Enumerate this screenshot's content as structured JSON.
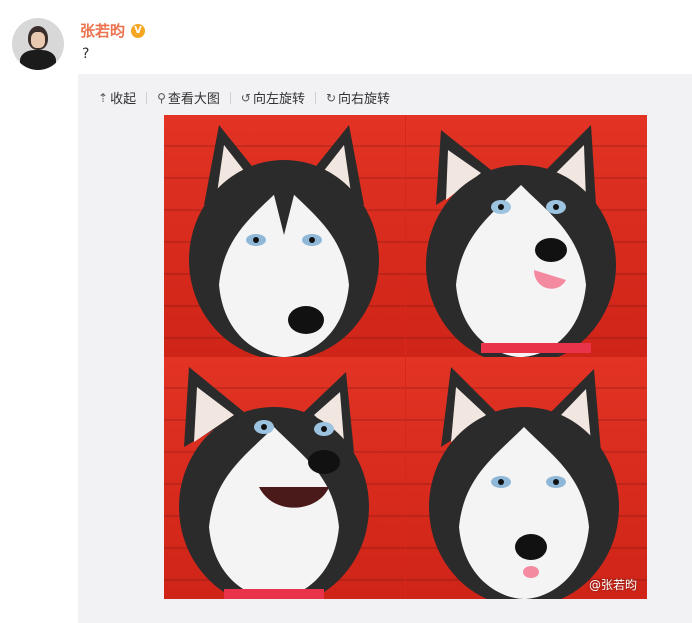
{
  "author": {
    "name": "张若昀",
    "verified_badge": "V"
  },
  "post": {
    "text": "?"
  },
  "toolbar": {
    "collapse_label": "收起",
    "view_large_label": "查看大图",
    "rotate_left_label": "向左旋转",
    "rotate_right_label": "向右旋转"
  },
  "photo": {
    "watermark": "@张若昀",
    "description_icons": [
      "husky-photo"
    ]
  },
  "colors": {
    "author_name": "#eb7350",
    "badge": "#f5a623",
    "photo_background": "#d8261b",
    "media_box": "#f2f2f5"
  }
}
